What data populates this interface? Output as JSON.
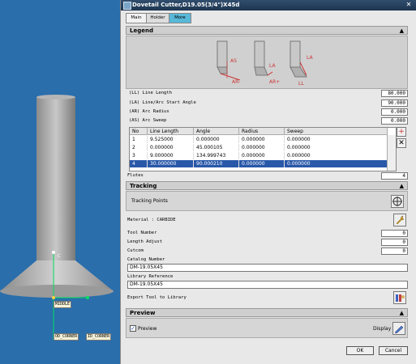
{
  "viewport": {
    "labels": {
      "middle": "MIDDLE",
      "od_corner": "OD_CORNER",
      "id_corner": "ID_CORNER",
      "axis_c": "C"
    }
  },
  "dialog": {
    "title": "Dovetail Cutter,D19.05(3/4\")X45d",
    "tabs": [
      "Main",
      "Holder",
      "More"
    ],
    "active_tab": "More",
    "legend": {
      "header": "Legend",
      "labels": {
        "as": "AS",
        "ar_minus": "AR-",
        "la1": "LA",
        "ar_plus": "AR+",
        "la2": "LA",
        "ll": "LL"
      }
    },
    "params": [
      {
        "label": "(LL) Line Length",
        "value": "80.000"
      },
      {
        "label": "(LA) Line/Arc Start Angle",
        "value": "90.000"
      },
      {
        "label": "(AR) Arc Radius",
        "value": "0.000"
      },
      {
        "label": "(AS) Arc Sweep",
        "value": "0.000"
      }
    ],
    "grid": {
      "columns": [
        "No",
        "Line Length",
        "Angle",
        "Radius",
        "Sweep"
      ],
      "rows": [
        [
          "1",
          "9.525000",
          "0.000000",
          "0.000000",
          "0.000000"
        ],
        [
          "2",
          "0.000000",
          "45.000105",
          "0.000000",
          "0.000000"
        ],
        [
          "3",
          "9.000000",
          "134.999743",
          "0.000000",
          "0.000000"
        ],
        [
          "4",
          "30.000000",
          "90.000210",
          "0.000000",
          "0.000000"
        ]
      ],
      "selected_row": 4
    },
    "flutes": {
      "label": "Flutes",
      "value": "4"
    },
    "tracking": {
      "header": "Tracking",
      "points_label": "Tracking Points"
    },
    "material": "Material : CARBIDE",
    "tool_number": {
      "label": "Tool Number",
      "value": "0"
    },
    "length_adjust": {
      "label": "Length Adjust",
      "value": "0"
    },
    "cutcom": {
      "label": "Cutcom",
      "value": "0"
    },
    "catalog_number": {
      "label": "Catalog Number",
      "value": "DM-19.05X45"
    },
    "library_reference": {
      "label": "Library Reference",
      "value": "DM-19.05X45"
    },
    "export_label": "Export Tool to Library",
    "preview": {
      "header": "Preview",
      "checkbox_label": "Preview",
      "display_label": "Display"
    },
    "ok_label": "OK",
    "cancel_label": "Cancel"
  }
}
